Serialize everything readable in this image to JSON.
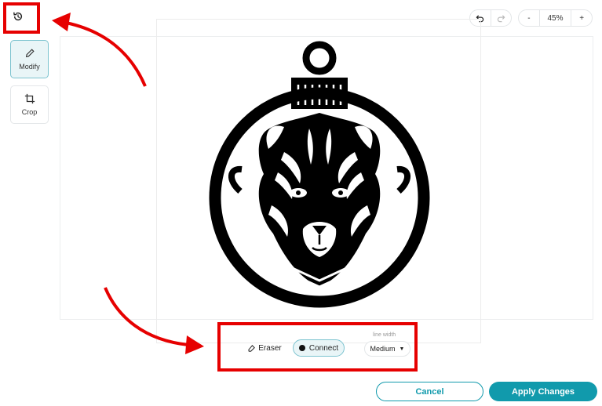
{
  "toolbar": {
    "history_icon": "history-icon",
    "modify_label": "Modify",
    "crop_label": "Crop"
  },
  "topbar": {
    "undo_icon": "undo-icon",
    "redo_icon": "redo-icon",
    "zoom_out_label": "-",
    "zoom_level": "45%",
    "zoom_in_label": "+"
  },
  "canvas": {
    "image_subject": "tiger ornament"
  },
  "modify_tools": {
    "eraser_label": "Eraser",
    "connect_label": "Connect",
    "line_width_label": "line width",
    "line_width_value": "Medium"
  },
  "footer": {
    "cancel_label": "Cancel",
    "apply_label": "Apply Changes"
  },
  "colors": {
    "accent": "#119aac",
    "annotation": "#e60000"
  }
}
